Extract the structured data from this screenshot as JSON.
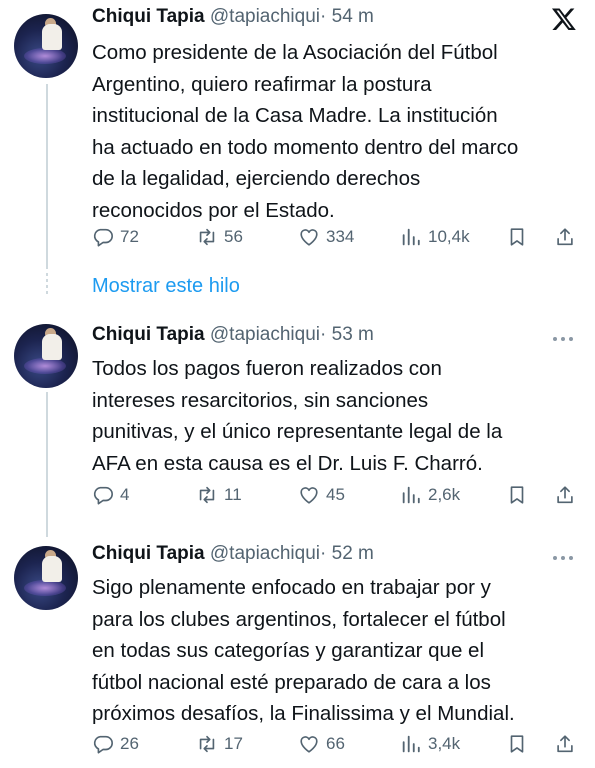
{
  "tweets": [
    {
      "name": "Chiqui Tapia",
      "handle": "@tapiachiqui",
      "dot": "·",
      "time": "54 m",
      "lines": [
        "Como presidente de la Asociación del Fútbol",
        "Argentino, quiero reafirmar la postura",
        "institucional de la Casa Madre. La institución",
        "ha actuado en todo momento dentro del marco",
        "de la legalidad, ejerciendo derechos",
        "reconocidos por el Estado."
      ],
      "replies": "72",
      "retweets": "56",
      "likes": "334",
      "views": "10,4k"
    },
    {
      "name": "Chiqui Tapia",
      "handle": "@tapiachiqui",
      "dot": "·",
      "time": "53 m",
      "lines": [
        "Todos los pagos fueron realizados con",
        "intereses resarcitorios, sin sanciones",
        "punitivas, y el único representante legal de la",
        "AFA en esta causa es el Dr. Luis F. Charró."
      ],
      "replies": "4",
      "retweets": "11",
      "likes": "45",
      "views": "2,6k"
    },
    {
      "name": "Chiqui Tapia",
      "handle": "@tapiachiqui",
      "dot": "·",
      "time": "52 m",
      "lines": [
        "Sigo plenamente enfocado en trabajar por y",
        "para los clubes argentinos, fortalecer el fútbol",
        "en todas sus categorías y garantizar que el",
        "fútbol nacional esté preparado de cara a los",
        "próximos desafíos, la Finalissima y el Mundial."
      ],
      "replies": "26",
      "retweets": "17",
      "likes": "66",
      "views": "3,4k"
    }
  ],
  "show_thread_label": "Mostrar este hilo",
  "icons": {
    "brand": "x-logo-icon",
    "more": "more-icon",
    "reply": "reply-icon",
    "retweet": "retweet-icon",
    "like": "like-icon",
    "views": "views-icon",
    "bookmark": "bookmark-icon",
    "share": "share-icon"
  },
  "colors": {
    "text": "#0f1419",
    "muted": "#536471",
    "link": "#1d9bf0",
    "thread_line": "#cfd9de"
  }
}
